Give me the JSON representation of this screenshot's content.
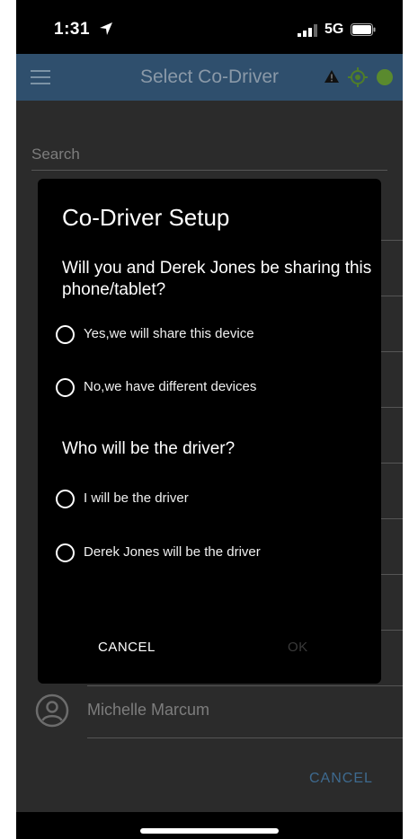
{
  "status_bar": {
    "time": "1:31",
    "network": "5G"
  },
  "app_bar": {
    "title": "Select Co-Driver"
  },
  "search": {
    "label": "Search"
  },
  "driver_list": {
    "visible_name": "Michelle Marcum"
  },
  "background_cancel": "CANCEL",
  "dialog": {
    "title": "Co-Driver Setup",
    "question_share": "Will you and Derek Jones be sharing this phone/tablet?",
    "share_options": [
      "Yes,we will share this device",
      "No,we have different devices"
    ],
    "question_driver": "Who will be the driver?",
    "driver_options": [
      "I will be the driver",
      "Derek Jones will be the driver"
    ],
    "cancel_label": "CANCEL",
    "ok_label": "OK"
  },
  "colors": {
    "app_bar": "#2f4f6d",
    "accent": "#3e6a8f",
    "status_dot": "#5a8a2e"
  }
}
